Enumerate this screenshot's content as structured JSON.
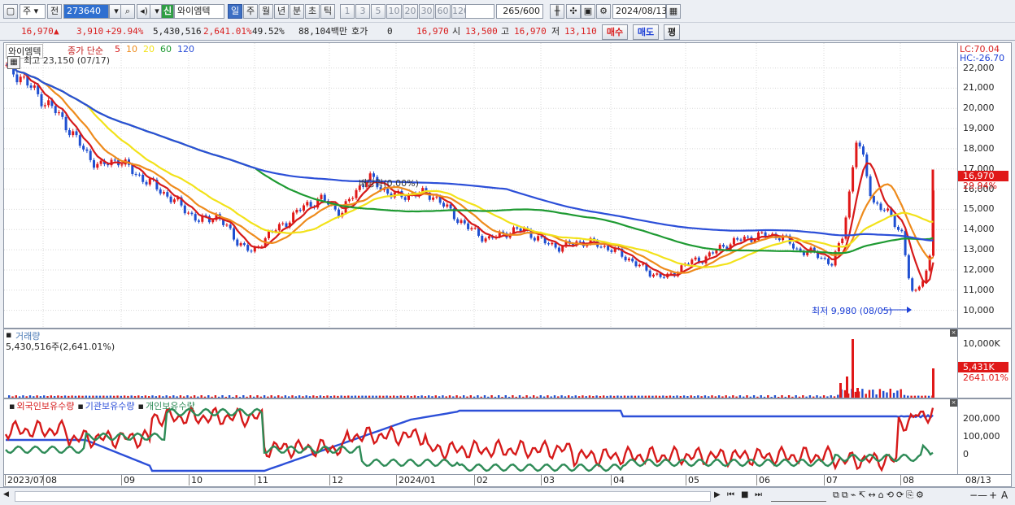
{
  "toolbar": {
    "period_type": "주",
    "prev_label": "전",
    "code": "273640",
    "stock_badge": "신",
    "stock_name": "와이엠텍",
    "period_buttons": [
      "일",
      "주",
      "월",
      "년",
      "분",
      "초",
      "틱"
    ],
    "interval_buttons": [
      "1",
      "3",
      "5",
      "10",
      "20",
      "30",
      "60",
      "120"
    ],
    "count": "265",
    "count_total": "/600",
    "date": "2024/08/13"
  },
  "quote": {
    "price": "16,970",
    "change": "3,910",
    "change_pct": "+29.94%",
    "volume": "5,430,516",
    "vol_ratio": "2,641.01%",
    "turnover": "49.52%",
    "amount": "88,104백만",
    "hoga_label": "호가",
    "hoga_value": "0",
    "ask_price": "16,970",
    "open_label": "시",
    "open": "13,500",
    "high_label": "고",
    "high": "16,970",
    "low_label": "저",
    "low": "13,110",
    "buy_label": "매수",
    "sell_label": "매도",
    "eval_label": "평"
  },
  "price_panel": {
    "stock_tag": "와이엠텍",
    "ma_title": "종가 단순",
    "ma_periods": [
      "5",
      "10",
      "20",
      "60",
      "120"
    ],
    "ma_colors": [
      "#d61a1a",
      "#ee8b1c",
      "#f2e21a",
      "#1e9a32",
      "#2c4fd8"
    ],
    "high_note": "최고 23,150 (07/17)",
    "low_note": "최저 9,980 (08/05)",
    "dividend_note": "배당락(0.00%)",
    "lc_label": "LC:70.04",
    "hc_label": "HC:-26.70",
    "last_price_tag": "16,970",
    "last_pct_tag": "29.94%",
    "y_ticks": [
      "22,000",
      "21,000",
      "20,000",
      "19,000",
      "18,000",
      "17,000",
      "16,000",
      "15,000",
      "14,000",
      "13,000",
      "12,000",
      "11,000",
      "10,000"
    ]
  },
  "volume_panel": {
    "title": "거래량",
    "value_text": "5,430,516주(2,641.01%)",
    "y_tick": "10,000K",
    "tag_value": "5,431K",
    "tag_pct": "2641.01%"
  },
  "holding_panel": {
    "legend": [
      "외국인보유수량",
      "기관보유수량",
      "개인보유수량"
    ],
    "legend_colors": [
      "#d61a1a",
      "#2c4fd8",
      "#2e8b57"
    ],
    "y_ticks": [
      "200,000",
      "100,000",
      "0"
    ]
  },
  "x_axis": {
    "labels": [
      "2023/07",
      "08",
      "09",
      "10",
      "11",
      "12",
      "2024/01",
      "02",
      "03",
      "04",
      "05",
      "06",
      "07",
      "08"
    ],
    "end_date": "08/13"
  },
  "chart_data": {
    "type": "candlestick",
    "unit": "KRW",
    "ylim": [
      9800,
      22500
    ],
    "series": [
      {
        "name": "종가",
        "x": [
          "2023/07",
          "2023/08",
          "2023/09",
          "2023/10",
          "2023/11",
          "2023/12",
          "2024/01",
          "2024/02",
          "2024/03",
          "2024/04",
          "2024/05",
          "2024/06",
          "2024/07",
          "2024/08/05",
          "2024/08/13"
        ],
        "values": [
          22000,
          19000,
          17300,
          14500,
          13500,
          15600,
          15800,
          14000,
          13400,
          12300,
          12500,
          13700,
          18500,
          9980,
          16970
        ]
      }
    ]
  }
}
